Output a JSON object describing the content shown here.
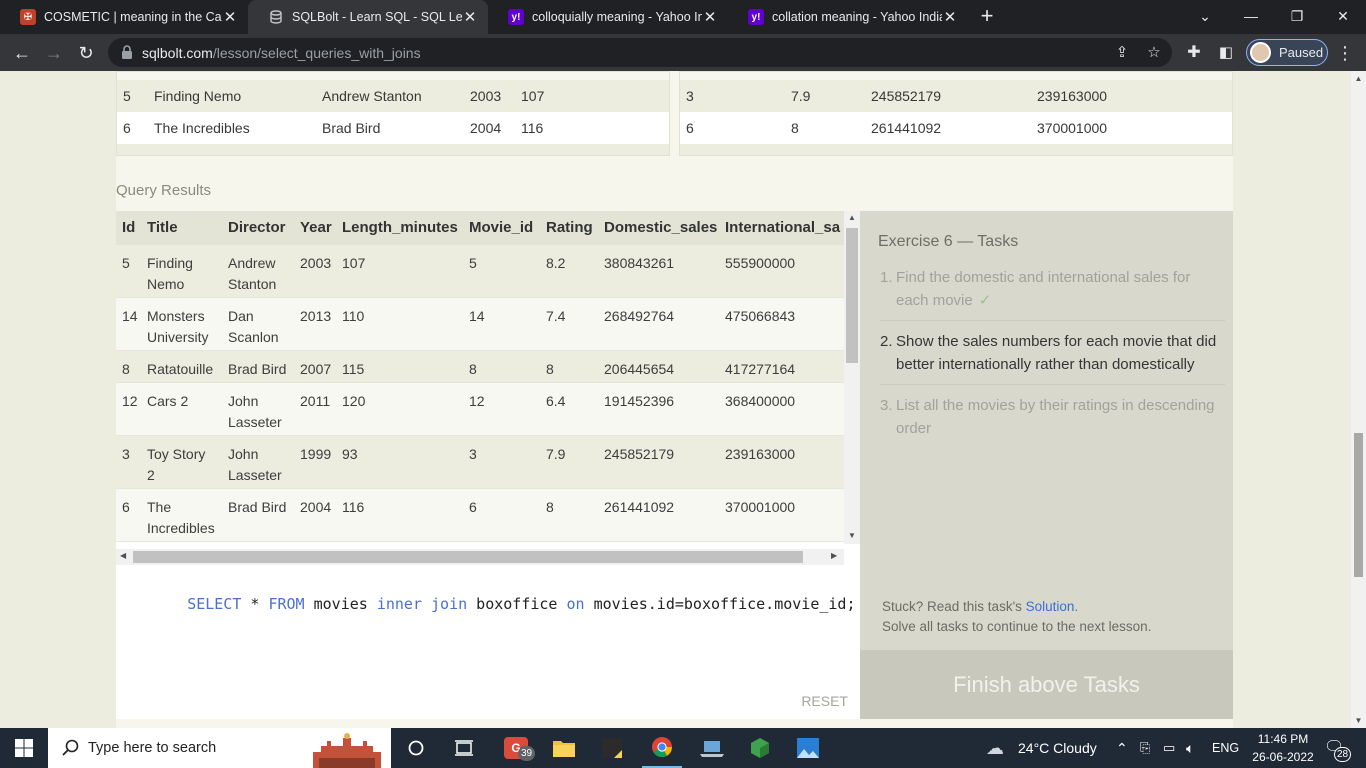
{
  "browser": {
    "tabs": [
      {
        "title": "COSMETIC | meaning in the Cam",
        "favicon": "cambridge-icon",
        "favicon_color": "#c1402a",
        "active": false
      },
      {
        "title": "SQLBolt - Learn SQL - SQL Lesson",
        "favicon": "database-icon",
        "favicon_color": "#9aa0a6",
        "active": true
      },
      {
        "title": "colloquially meaning - Yahoo Ind",
        "favicon": "yahoo-icon",
        "favicon_color": "#6001d2",
        "active": false
      },
      {
        "title": "collation meaning - Yahoo India",
        "favicon": "yahoo-icon",
        "favicon_color": "#6001d2",
        "active": false
      }
    ],
    "url_domain": "sqlbolt.com",
    "url_path": "/lesson/select_queries_with_joins",
    "profile_label": "Paused"
  },
  "top_tables": {
    "left_rows": [
      {
        "id": "5",
        "title": "Finding Nemo",
        "director": "Andrew Stanton",
        "year": "2003",
        "length": "107"
      },
      {
        "id": "6",
        "title": "The Incredibles",
        "director": "Brad Bird",
        "year": "2004",
        "length": "116"
      }
    ],
    "right_rows": [
      {
        "movie_id": "3",
        "rating": "7.9",
        "domestic": "245852179",
        "international": "239163000"
      },
      {
        "movie_id": "6",
        "rating": "8",
        "domestic": "261441092",
        "international": "370001000"
      }
    ]
  },
  "query_results": {
    "label": "Query Results",
    "columns": [
      "Id",
      "Title",
      "Director",
      "Year",
      "Length_minutes",
      "Movie_id",
      "Rating",
      "Domestic_sales",
      "International_sa"
    ],
    "rows": [
      [
        "5",
        "Finding\nNemo",
        "Andrew\nStanton",
        "2003",
        "107",
        "5",
        "8.2",
        "380843261",
        "555900000"
      ],
      [
        "14",
        "Monsters\nUniversity",
        "Dan\nScanlon",
        "2013",
        "110",
        "14",
        "7.4",
        "268492764",
        "475066843"
      ],
      [
        "8",
        "Ratatouille",
        "Brad Bird",
        "2007",
        "115",
        "8",
        "8",
        "206445654",
        "417277164"
      ],
      [
        "12",
        "Cars 2",
        "John\nLasseter",
        "2011",
        "120",
        "12",
        "6.4",
        "191452396",
        "368400000"
      ],
      [
        "3",
        "Toy Story\n2",
        "John\nLasseter",
        "1999",
        "93",
        "3",
        "7.9",
        "245852179",
        "239163000"
      ],
      [
        "6",
        "The\nIncredibles",
        "Brad Bird",
        "2004",
        "116",
        "6",
        "8",
        "261441092",
        "370001000"
      ]
    ]
  },
  "editor": {
    "query_parts": [
      {
        "t": "SELECT",
        "kw": true
      },
      {
        "t": " * ",
        "kw": false
      },
      {
        "t": "FROM",
        "kw": true
      },
      {
        "t": " movies ",
        "kw": false
      },
      {
        "t": "inner join",
        "kw": true
      },
      {
        "t": " boxoffice ",
        "kw": false
      },
      {
        "t": "on",
        "kw": true
      },
      {
        "t": " movies.id=boxoffice.movie_id;",
        "kw": false
      }
    ],
    "reset_label": "RESET"
  },
  "tasks": {
    "heading": "Exercise 6 — Tasks",
    "items": [
      {
        "num": "1.",
        "text": "Find the domestic and international sales for each movie",
        "state": "done"
      },
      {
        "num": "2.",
        "text": "Show the sales numbers for each movie that did better internationally rather than domestically",
        "state": "current"
      },
      {
        "num": "3.",
        "text": "List all the movies by their ratings in descending order",
        "state": "todo"
      }
    ],
    "check_mark": "✓",
    "stuck_prefix": "Stuck? Read this task's ",
    "solution_link": "Solution",
    "stuck_suffix": ".",
    "continue_text": "Solve all tasks to continue to the next lesson.",
    "finish_label": "Finish above Tasks"
  },
  "taskbar": {
    "search_placeholder": "Type here to search",
    "badge_count": "39",
    "weather": "24°C  Cloudy",
    "language": "ENG",
    "time": "11:46 PM",
    "date": "26-06-2022",
    "notification_count": "28"
  }
}
